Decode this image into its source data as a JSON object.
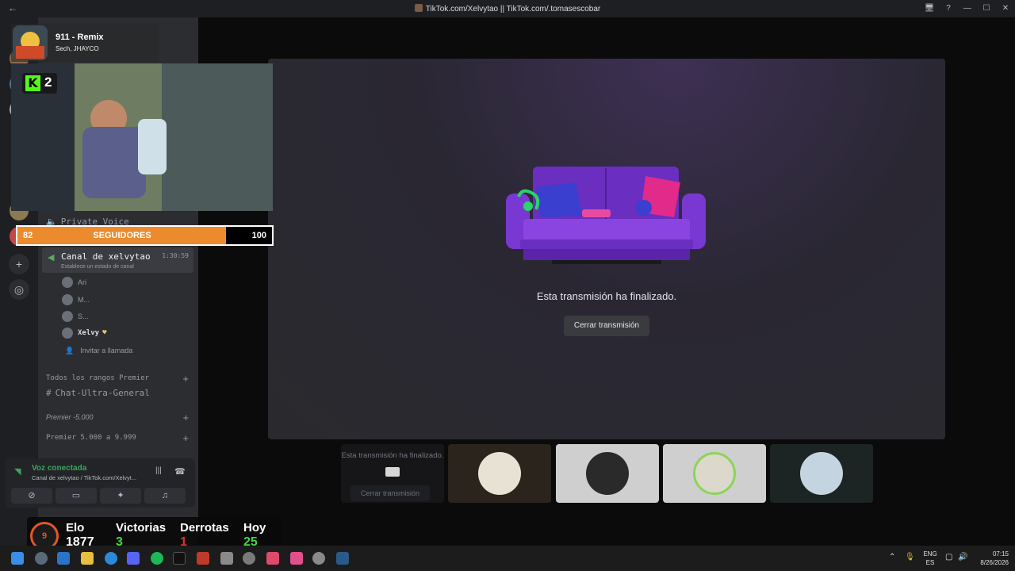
{
  "window": {
    "title": "TikTok.com/Xelvytao || TikTok.com/.tomasescobar",
    "controls": [
      "🖥",
      "?",
      "—",
      "☐",
      "✕"
    ]
  },
  "now_playing": {
    "song": "911 - Remix",
    "artist": "Sech, JHAYCO"
  },
  "kick": {
    "letter": "K",
    "count": "2"
  },
  "followers": {
    "current": "82",
    "label": "SEGUIDORES",
    "goal": "100",
    "progress": 0.82,
    "fill_color": "#ec8b2e"
  },
  "sidebar": {
    "private_voice": "Private Voice",
    "voice_channel": {
      "name": "Canal de xelvytao",
      "time": "1:30:59",
      "status": "Establece un estado de canal"
    },
    "members": [
      "Ari",
      "M...",
      "S...",
      "Xelvy"
    ],
    "invite": "Invitar a llamada",
    "sections": [
      {
        "label": "Todos los rangos Premier"
      },
      {
        "label": "Chat-Ultra-General"
      },
      {
        "label": "Premier -5.000"
      },
      {
        "label": "Premier 5.000 a 9.999"
      }
    ]
  },
  "voice_panel": {
    "title": "Voz conectada",
    "subtitle": "Canal de xelvytao / TikTok.com/Xelvyt..."
  },
  "stream": {
    "ended_text": "Esta transmisión ha finalizado.",
    "close_button": "Cerrar transmisión"
  },
  "thumbnails": {
    "first_text": "Esta transmisión ha finalizado.",
    "first_button": "Cerrar transmisión"
  },
  "stats": {
    "rank": "9",
    "elo_label": "Elo",
    "elo_value": "1877",
    "wins_label": "Victorias",
    "wins_value": "3",
    "losses_label": "Derrotas",
    "losses_value": "1",
    "today_label": "Hoy",
    "today_value": "25"
  },
  "taskbar": {
    "lang_top": "ENG",
    "lang_bottom": "ES",
    "time": "07:15",
    "date": "8/26/2026"
  }
}
